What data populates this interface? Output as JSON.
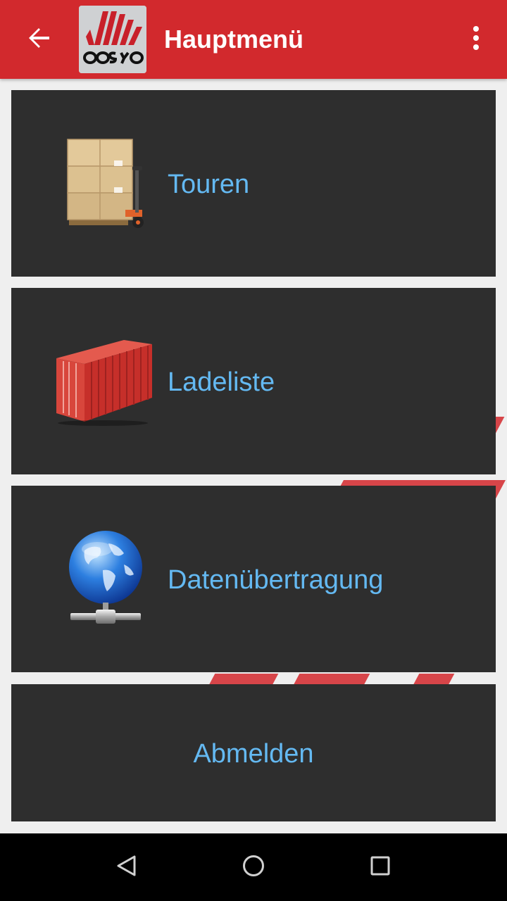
{
  "app_bar": {
    "title": "Hauptmenü",
    "background_color": "#d2292d",
    "back_icon": "arrow-left-icon",
    "logo": "cosyo-logo",
    "overflow_icon": "more-vert-icon"
  },
  "menu": {
    "label_color": "#64b9f2",
    "tile_color": "#2e2e2e",
    "items": [
      {
        "label": "Touren",
        "icon": "pallet-jack-boxes-icon"
      },
      {
        "label": "Ladeliste",
        "icon": "shipping-container-icon"
      },
      {
        "label": "Datenübertragung",
        "icon": "network-globe-icon"
      },
      {
        "label": "Abmelden",
        "icon": ""
      }
    ]
  },
  "nav_bar": {
    "back_icon": "nav-back-triangle-icon",
    "home_icon": "nav-home-circle-icon",
    "recents_icon": "nav-recents-square-icon"
  }
}
